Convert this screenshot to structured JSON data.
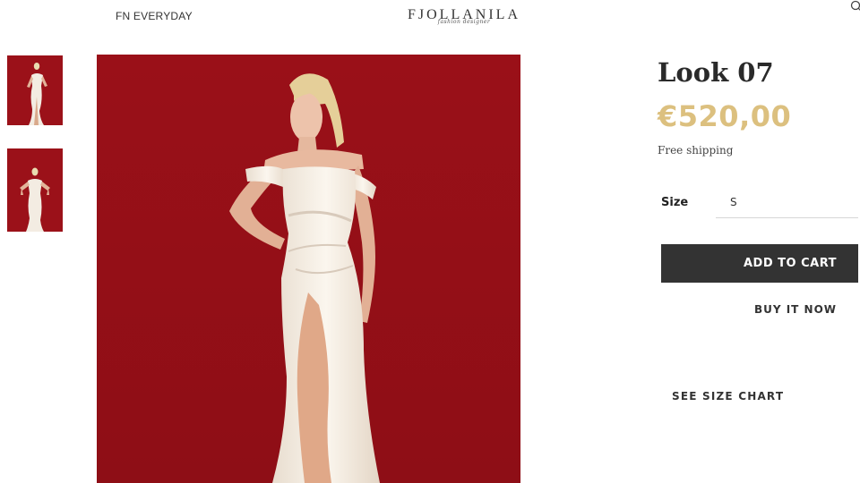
{
  "header": {
    "nav_link": "FN EVERYDAY",
    "logo_text": "FJOLLANILA",
    "logo_tagline": "fashion designer"
  },
  "gallery": {
    "thumbnails": [
      "thumbnail-1",
      "thumbnail-2"
    ],
    "background_color": "#9b1119",
    "dress_color": "#f3ece2"
  },
  "product": {
    "title": "Look 07",
    "price": "€520,00",
    "shipping": "Free shipping",
    "size_label": "Size",
    "size_value": "S",
    "add_to_cart": "ADD TO CART",
    "buy_now": "BUY IT NOW",
    "size_chart": "SEE SIZE CHART"
  },
  "colors": {
    "price": "#dcc07f",
    "button": "#333333"
  },
  "icons": {
    "header_right": "search-icon"
  }
}
